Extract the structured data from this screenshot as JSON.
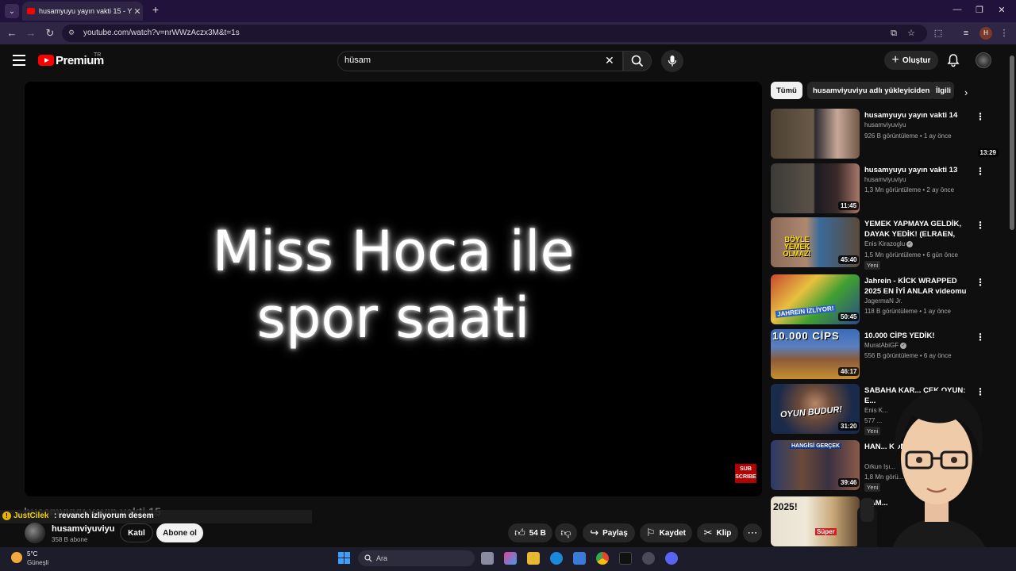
{
  "browser": {
    "tab_title": "husamyuyu yayın vakti 15 - You",
    "url": "youtube.com/watch?v=nrWWzAczx3M&t=1s",
    "profile_initial": "H"
  },
  "header": {
    "logo_text": "Premium",
    "region": "TR",
    "search_value": "hüsam",
    "create_label": "Oluştur"
  },
  "video": {
    "overlay_line1": "Miss Hoca ile",
    "overlay_line2": "spor saati",
    "sub_badge_line1": "SUB",
    "sub_badge_line2": "SCRIBE",
    "title": "husamyuyu yayın vakti 15"
  },
  "chat": {
    "user": "JustCilek",
    "message": ": revanch izliyorum desem"
  },
  "channel": {
    "name": "husamviyuviyu",
    "subscribers": "358 B abone",
    "join_label": "Katıl",
    "subscribe_label": "Abone ol"
  },
  "actions": {
    "likes": "54 B",
    "share": "Paylaş",
    "save": "Kaydet",
    "clip": "Klip"
  },
  "chips": [
    {
      "label": "Tümü"
    },
    {
      "label": "husamviyuviyu adlı yükleyiciden"
    },
    {
      "label": "İlgili"
    }
  ],
  "recommendations": [
    {
      "title": "husamyuyu yayın vakti 14",
      "channel": "husamviyuviyu",
      "stats": "926 B görüntüleme • 1 ay önce",
      "duration": "13:29",
      "badge": ""
    },
    {
      "title": "husamyuyu yayın vakti 13",
      "channel": "husamviyuviyu",
      "stats": "1,3 Mn görüntüleme • 2 ay önce",
      "duration": "11:45",
      "badge": ""
    },
    {
      "title": "YEMEK YAPMAYA GELDİK, DAYAK YEDİK! (ELRAEN, ERAY,...",
      "channel": "Enis Kirazoglu",
      "stats": "1,5 Mn görüntüleme • 6 gün önce",
      "duration": "45:40",
      "badge": "Yeni"
    },
    {
      "title": "Jahrein - KİCK WRAPPED 2025 EN İYİ ANLAR videomu izliyor",
      "channel": "JagermaN Jr.",
      "stats": "118 B görüntüleme • 1 ay önce",
      "duration": "50:45",
      "badge": ""
    },
    {
      "title": "10.000 CİPS YEDİK!",
      "channel": "MuratAbiGF",
      "stats": "556 B görüntüleme • 6 ay önce",
      "duration": "46:17",
      "badge": ""
    },
    {
      "title": "SABAHA KAR... ÇEK OYUN: E...",
      "channel": "Enis K...",
      "stats": "577 ...",
      "duration": "31:20",
      "badge": "Yeni"
    },
    {
      "title": "HAN... KOME...",
      "channel": "Orkun Işı...",
      "stats": "1,8 Mn görü...",
      "duration": "39:46",
      "badge": "Yeni"
    },
    {
      "title": "RAM...",
      "channel": "",
      "stats": "",
      "duration": "",
      "badge": ""
    }
  ],
  "thumb_texts": {
    "t3": "BÖYLE YEMEK OLMAZ!",
    "t4": "JAHREIN İZLİYOR!",
    "t5": "10.000 CİPS",
    "t6": "OYUN BUDUR!",
    "t7": "HANGİSİ GERÇEK",
    "t8a": "2025!",
    "t8b": "Süper"
  },
  "taskbar": {
    "temp": "5°C",
    "weather": "Güneşli",
    "search_placeholder": "Ara"
  },
  "colors": {
    "background": "#0f0f0f",
    "brand_red": "#ff0000",
    "chat_user": "#f4d100",
    "tab_bar": "#20123a"
  }
}
